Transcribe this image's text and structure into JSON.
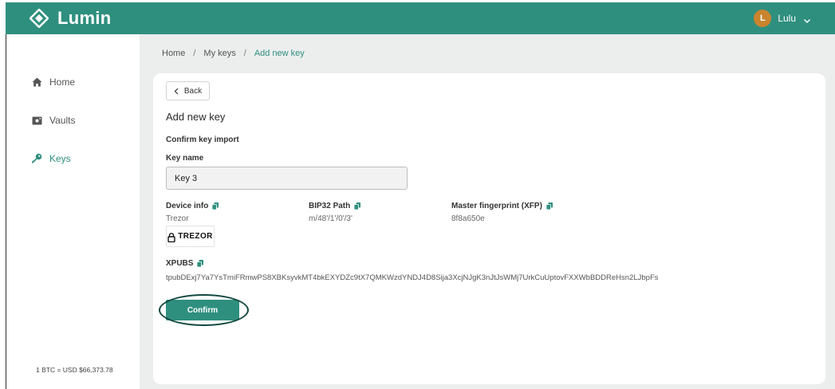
{
  "app": {
    "name": "Lumin",
    "accent": "#2f8f7f",
    "logo_icon": "diamond-logo-icon"
  },
  "user": {
    "initial": "L",
    "name": "Lulu",
    "avatar_color": "#c9842d",
    "menu_icon": "chevron-down-icon"
  },
  "sidebar": {
    "items": [
      {
        "label": "Home",
        "icon": "home-icon",
        "active": false
      },
      {
        "label": "Vaults",
        "icon": "vault-icon",
        "active": false
      },
      {
        "label": "Keys",
        "icon": "key-icon",
        "active": true
      }
    ],
    "btc_price": "1 BTC = USD $66,373.78"
  },
  "breadcrumb": {
    "items": [
      "Home",
      "My keys",
      "Add new key"
    ],
    "separator": "/"
  },
  "page": {
    "back_label": "Back",
    "title": "Add new key",
    "section_title": "Confirm key import",
    "key_name": {
      "label": "Key name",
      "value": "Key 3"
    },
    "device_info": {
      "label": "Device info",
      "value": "Trezor",
      "logo_text": "TREZOR"
    },
    "bip32_path": {
      "label": "BIP32 Path",
      "value": "m/48'/1'/0'/3'"
    },
    "master_fingerprint": {
      "label": "Master fingerprint (XFP)",
      "value": "8f8a650e"
    },
    "xpubs": {
      "label": "XPUBS",
      "value": "tpubDExj7Ya7YsTmiFRmwPS8XBKsyvkMT4bkEXYDZc9tX7QMKWzdYNDJ4D8Sija3XcjNJgK3nJtJsWMj7UrkCuUptovFXXWbBDDReHsn2LJbpFs"
    },
    "confirm_label": "Confirm",
    "copy_icon": "copy-icon"
  }
}
